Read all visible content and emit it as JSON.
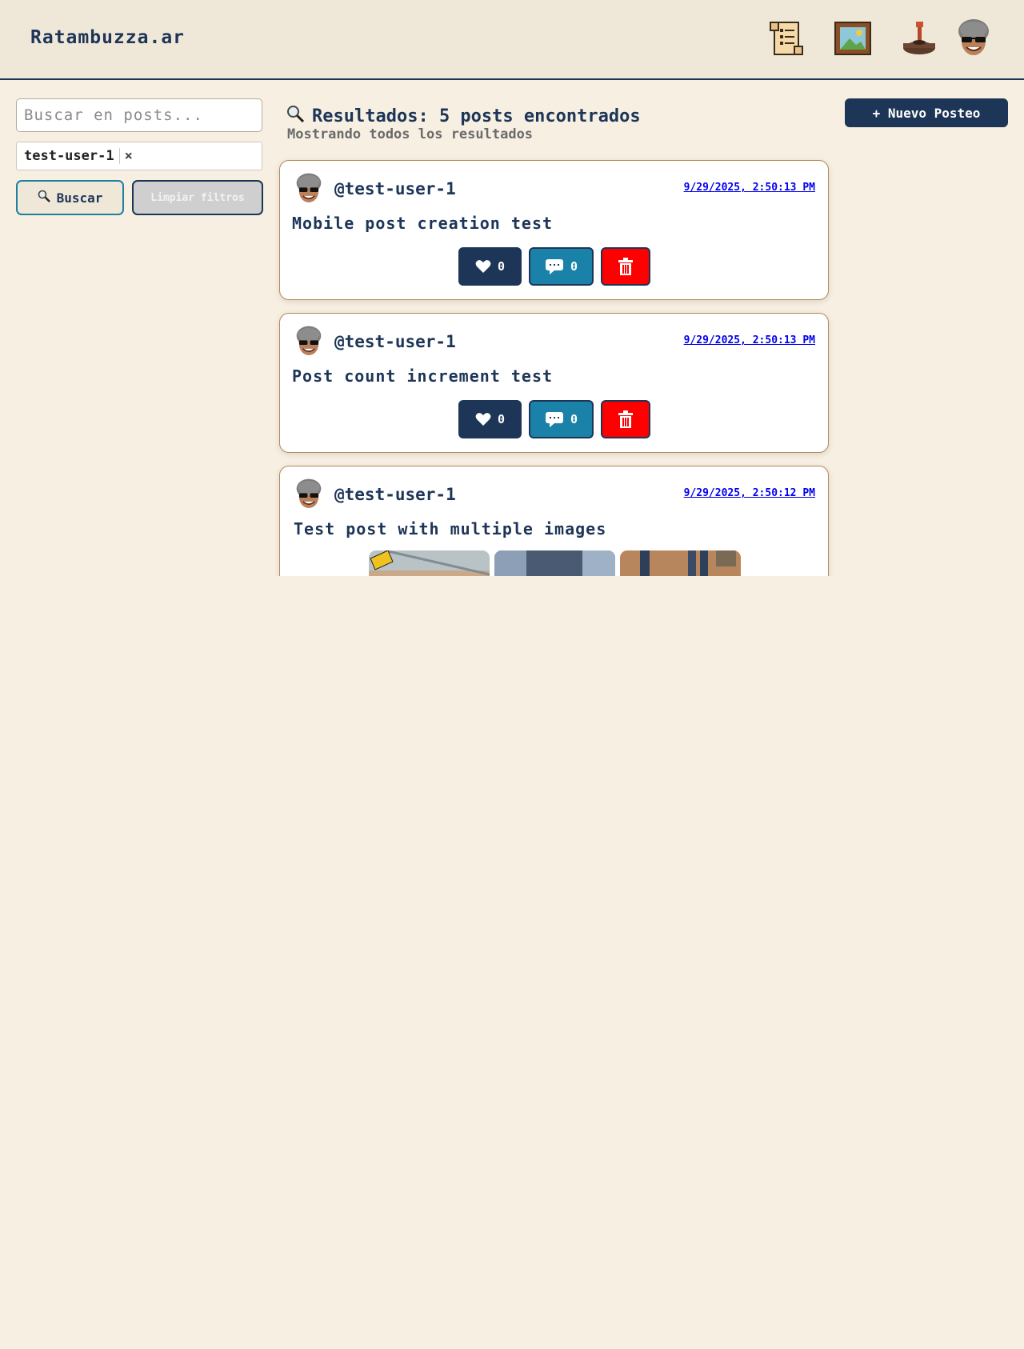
{
  "header": {
    "brand": "Ratambuzza.ar",
    "nav": [
      {
        "icon": "scroll-icon"
      },
      {
        "icon": "picture-frame-icon"
      },
      {
        "icon": "joystick-icon"
      },
      {
        "icon": "avatar"
      }
    ]
  },
  "sidebar": {
    "search_placeholder": "Buscar en posts...",
    "search_value": "",
    "filter_chip": {
      "label": "test-user-1",
      "close": "×"
    },
    "search_button": "Buscar",
    "clear_button": "Limpiar filtros"
  },
  "results": {
    "title": "Resultados: 5 posts encontrados",
    "subtitle": "Mostrando todos los resultados",
    "new_post_button": "+ Nuevo Posteo"
  },
  "posts": [
    {
      "user": "@test-user-1",
      "date": "9/29/2025, 2:50:13 PM",
      "text": "Mobile post creation test",
      "likes": "0",
      "comments": "0"
    },
    {
      "user": "@test-user-1",
      "date": "9/29/2025, 2:50:13 PM",
      "text": "Post count increment test",
      "likes": "0",
      "comments": "0"
    },
    {
      "user": "@test-user-1",
      "date": "9/29/2025, 2:50:12 PM",
      "text": "Test post with multiple images",
      "images": 3
    }
  ],
  "colors": {
    "background": "#f7f0e2",
    "header": "#efe8d9",
    "navy": "#1d3557",
    "teal": "#1a82a8",
    "danger": "#ff0000",
    "card_border": "#b68957",
    "link": "#0000ee"
  }
}
